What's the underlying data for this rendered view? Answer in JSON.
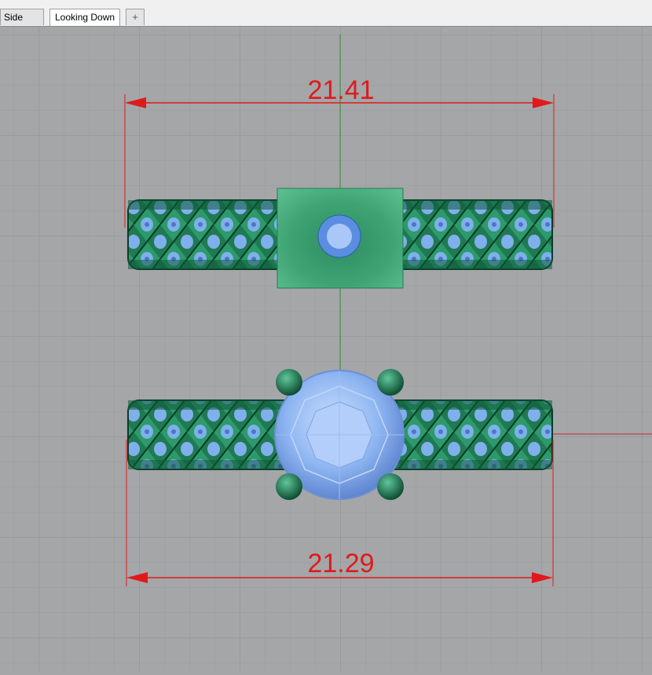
{
  "tabs": [
    {
      "label": "Side View",
      "active": false
    },
    {
      "label": "Looking Down",
      "active": true
    },
    {
      "label": "+",
      "active": false
    }
  ],
  "viewport": {
    "name": "Looking Down",
    "dimensions": {
      "top": "21.41",
      "bottom": "21.29"
    }
  },
  "colors": {
    "background": "#a4a6a8",
    "grid": "#8f9294",
    "dimension": "#e0191b",
    "metal": "#2f8a63",
    "stone": "#8fb8f5"
  }
}
